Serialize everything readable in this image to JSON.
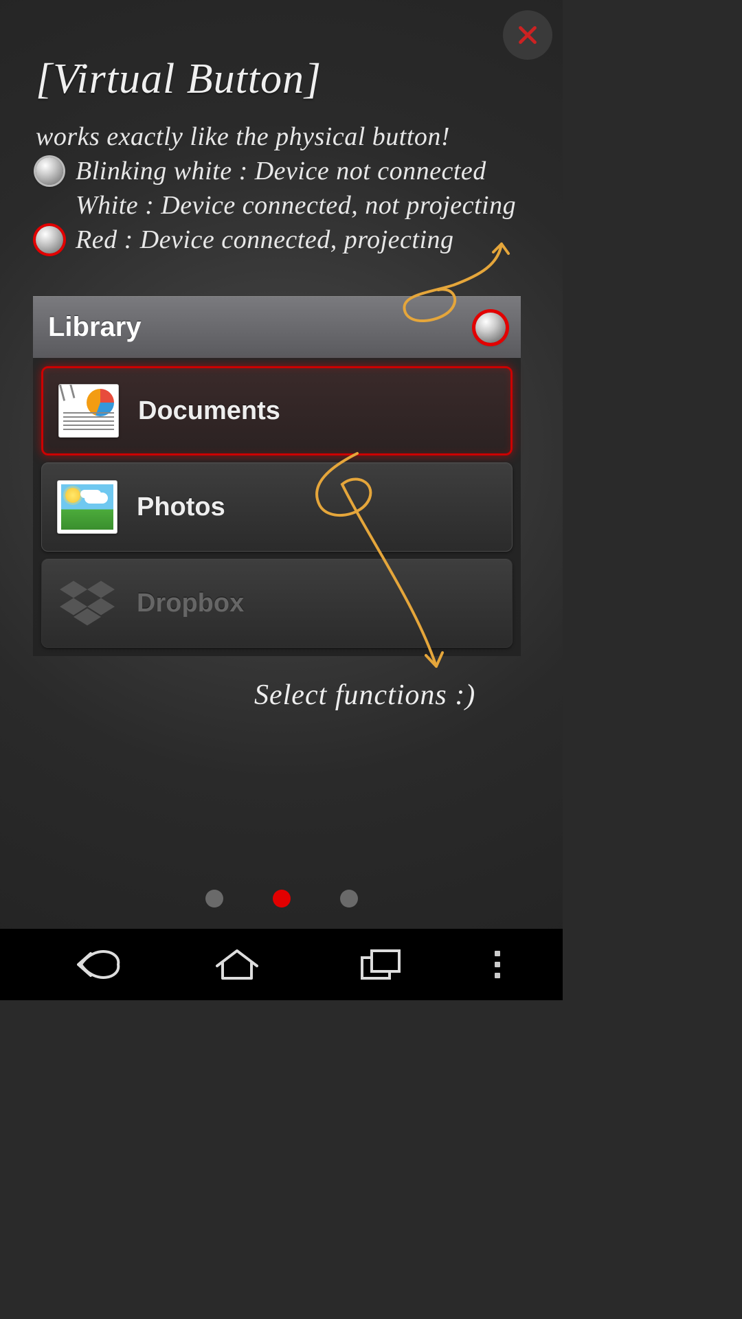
{
  "title": "[Virtual Button]",
  "subtitle": "works exactly like the physical button!",
  "status": {
    "blinking_white": "Blinking white : Device not connected",
    "white": "White : Device connected, not projecting",
    "red": "Red : Device connected, projecting"
  },
  "library": {
    "header": "Library",
    "items": [
      {
        "label": "Documents",
        "icon": "document-icon",
        "selected": true
      },
      {
        "label": "Photos",
        "icon": "photos-icon",
        "selected": false
      },
      {
        "label": "Dropbox",
        "icon": "dropbox-icon",
        "dimmed": true
      }
    ]
  },
  "hint": "Select functions :)",
  "pager": {
    "count": 3,
    "active_index": 1
  },
  "colors": {
    "accent_red": "#e20000",
    "arrow": "#e5a63b"
  }
}
